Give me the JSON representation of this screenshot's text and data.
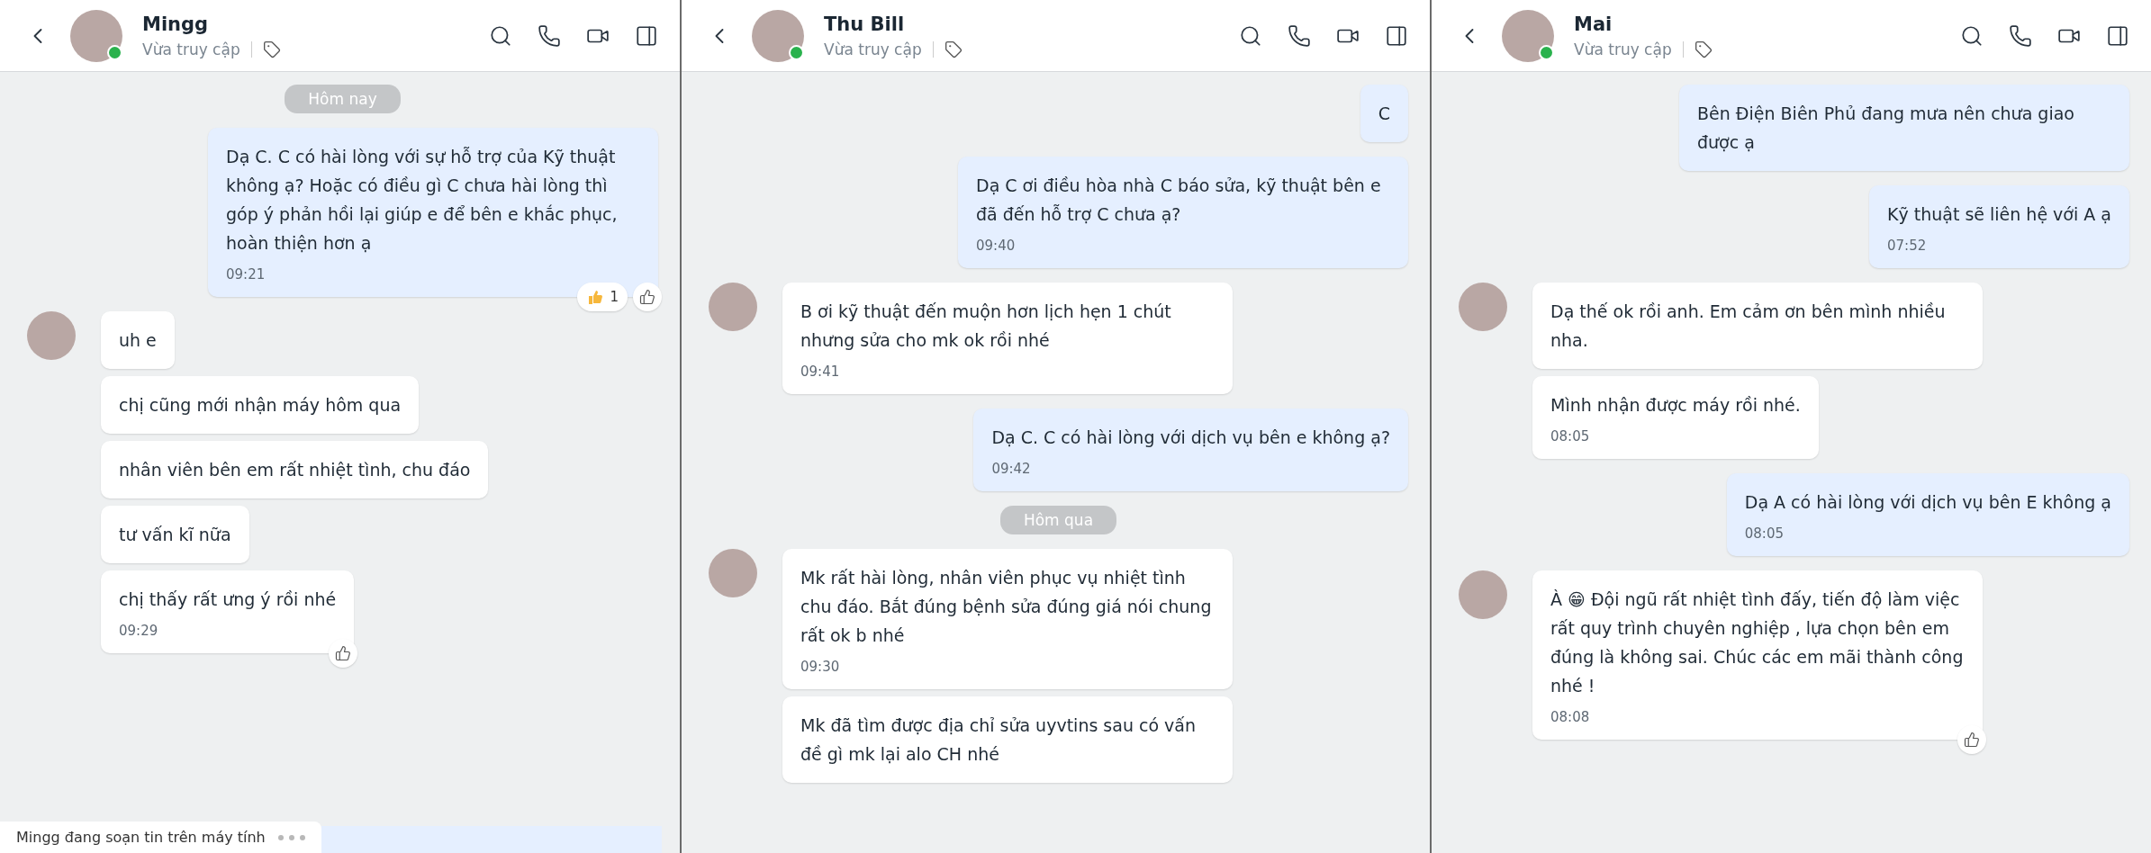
{
  "panels": [
    {
      "contact": {
        "name": "Mingg",
        "status": "Vừa truy cập",
        "online": true
      },
      "messages": [
        {
          "kind": "date",
          "text": "Hôm nay"
        },
        {
          "kind": "outgoing",
          "text": "Dạ C. C có hài lòng với sự hỗ trợ của Kỹ thuật không ạ? Hoặc có điều gì C chưa hài lòng thì góp ý phản hồi lại giúp e để bên e khắc phục, hoàn thiện hơn ạ",
          "time": "09:21",
          "reaction_count": "1",
          "like_button": true
        },
        {
          "kind": "incoming",
          "bubbles": [
            {
              "text": "uh e",
              "like_button": false
            },
            {
              "text": "chị cũng mới nhận máy hôm qua",
              "like_button": false
            },
            {
              "text": "nhân viên bên em rất nhiệt tình, chu đáo",
              "like_button": false
            },
            {
              "text": "tư vấn kĩ nữa",
              "like_button": false
            },
            {
              "text": "chị thấy rất ưng ý rồi nhé",
              "time": "09:29",
              "like_button": true
            }
          ]
        }
      ],
      "typing": "Mingg đang soạn tin trên máy tính"
    },
    {
      "contact": {
        "name": "Thu Bill",
        "status": "Vừa truy cập",
        "online": true
      },
      "messages": [
        {
          "kind": "outgoing",
          "text": "C",
          "like_button": false
        },
        {
          "kind": "outgoing",
          "text": "Dạ C ơi điều hòa nhà C báo sửa, kỹ thuật bên e đã đến hỗ trợ C chưa ạ?",
          "time": "09:40",
          "like_button": false
        },
        {
          "kind": "incoming",
          "bubbles": [
            {
              "text": "B ơi kỹ thuật đến muộn hơn lịch hẹn 1 chút nhưng sửa cho mk ok rồi nhé",
              "time": "09:41",
              "like_button": false
            }
          ]
        },
        {
          "kind": "outgoing",
          "text": "Dạ C. C có hài lòng với dịch vụ bên e không ạ?",
          "time": "09:42",
          "like_button": false
        },
        {
          "kind": "date",
          "text": "Hôm qua"
        },
        {
          "kind": "incoming",
          "bubbles": [
            {
              "text": "Mk rất hài lòng, nhân viên phục vụ nhiệt tình chu đáo. Bắt đúng bệnh sửa đúng giá nói chung rất ok b nhé",
              "time": "09:30",
              "like_button": false
            },
            {
              "text": "Mk đã tìm được địa chỉ sửa uyvtins sau có vấn đề gì mk lại alo CH nhé",
              "like_button": false
            }
          ]
        }
      ]
    },
    {
      "contact": {
        "name": "Mai",
        "status": "Vừa truy cập",
        "online": true
      },
      "messages": [
        {
          "kind": "outgoing",
          "text": "Bên Điện Biên Phủ đang mưa nên chưa giao được ạ",
          "like_button": false
        },
        {
          "kind": "outgoing",
          "text": "Kỹ thuật sẽ liên hệ với A ạ",
          "time": "07:52",
          "like_button": false
        },
        {
          "kind": "incoming",
          "bubbles": [
            {
              "text": "Dạ thế ok rồi anh.  Em cảm ơn bên mình nhiều nha.",
              "like_button": false
            },
            {
              "text": "Mình nhận được máy rồi nhé.",
              "time": "08:05",
              "like_button": false
            }
          ]
        },
        {
          "kind": "outgoing",
          "text": "Dạ A có hài lòng với dịch vụ bên E không ạ",
          "time": "08:05",
          "like_button": false
        },
        {
          "kind": "incoming",
          "bubbles": [
            {
              "text": "À 😁 Đội ngũ rất nhiệt tình đấy,  tiến độ làm việc rất quy trình chuyên nghiệp , lựa chọn bên em đúng là không sai. Chúc các em mãi thành công nhé !",
              "time": "08:08",
              "like_button": true
            }
          ]
        }
      ]
    }
  ]
}
